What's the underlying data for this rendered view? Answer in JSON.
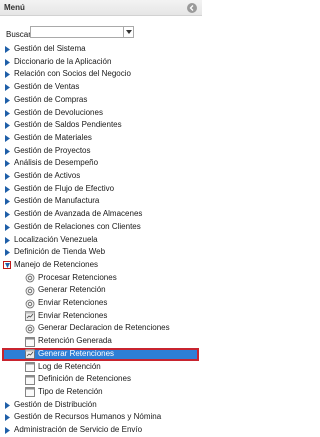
{
  "header": {
    "title": "Menú"
  },
  "search": {
    "label": "Buscar:",
    "value": "",
    "placeholder": ""
  },
  "menu": [
    "Gestión del Sistema",
    "Diccionario de la Aplicación",
    "Relación con Socios del Negocio",
    "Gestión de Ventas",
    "Gestión de Compras",
    "Gestión de Devoluciones",
    "Gestión de Saldos Pendientes",
    "Gestión de Materiales",
    "Gestión de Proyectos",
    "Análisis de Desempeño",
    "Gestión de Activos",
    "Gestión de Flujo de Efectivo",
    "Gestión de Manufactura",
    "Gestión de Avanzada de Almacenes",
    "Gestión de Relaciones con Clientes",
    "Localización Venezuela",
    "Definición de Tienda Web"
  ],
  "expanded": {
    "label": "Manejo de Retenciones",
    "children": [
      {
        "label": "Procesar Retenciones",
        "icon": "process-gear-icon"
      },
      {
        "label": "Generar Retención",
        "icon": "process-gear-icon"
      },
      {
        "label": "Enviar Retenciones",
        "icon": "process-gear-icon"
      },
      {
        "label": "Enviar Retenciones",
        "icon": "report-icon"
      },
      {
        "label": "Generar Declaracion de Retenciones",
        "icon": "process-gear-icon"
      },
      {
        "label": "Retención Generada",
        "icon": "window-icon"
      },
      {
        "label": "Generar Retenciones",
        "icon": "report-icon",
        "selected": true
      },
      {
        "label": "Log de Retención",
        "icon": "window-icon"
      },
      {
        "label": "Definición de Retenciones",
        "icon": "window-icon"
      },
      {
        "label": "Tipo de Retención",
        "icon": "window-icon"
      }
    ]
  },
  "menu_after": [
    "Gestión de Distribución",
    "Gestión de Recursos Humanos y Nómina",
    "Administración de Servicio de Envío"
  ],
  "colors": {
    "selected_bg": "#2e7fd6",
    "selected_border": "#c8242f",
    "triangle": "#1f5fa8"
  }
}
